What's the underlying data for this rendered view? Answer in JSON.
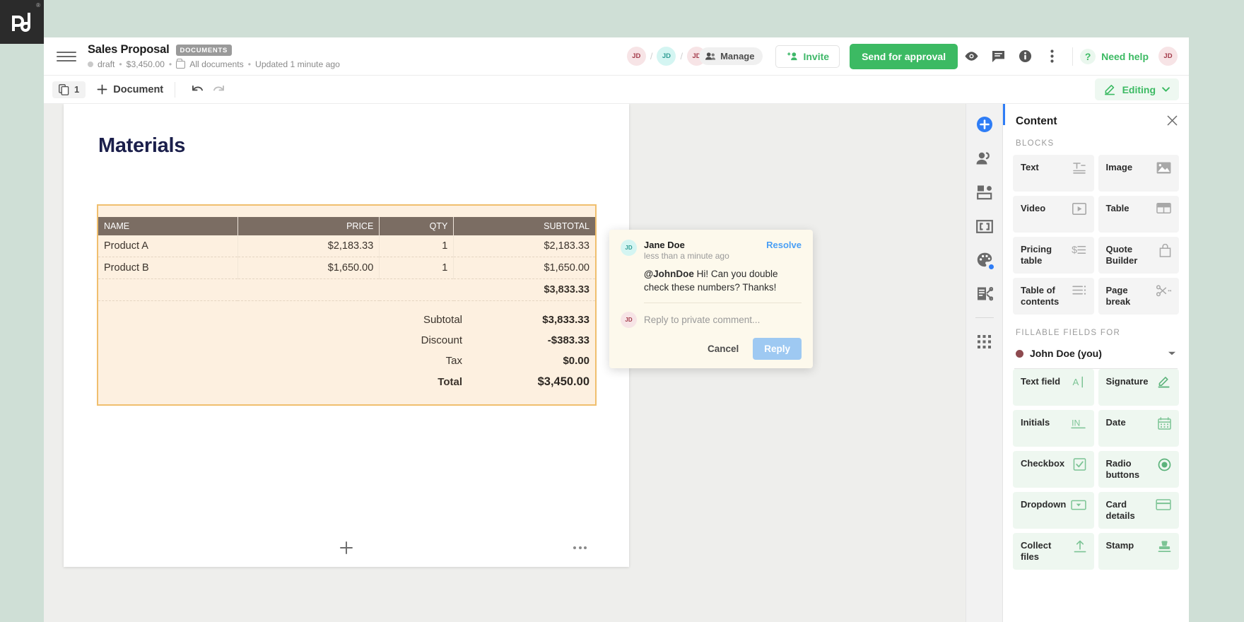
{
  "brand": {
    "logo_name": "pandadoc-logo",
    "registered_mark": "®"
  },
  "header": {
    "menu_icon": "hamburger-menu-icon",
    "title": "Sales Proposal",
    "badge": "DOCUMENTS",
    "status": "draft",
    "amount": "$3,450.00",
    "folder": "All documents",
    "updated": "Updated 1 minute ago",
    "sep": "•",
    "avatars": [
      {
        "initials": "JD",
        "color": "red"
      },
      {
        "initials": "JD",
        "color": "cyan"
      },
      {
        "initials": "JD",
        "color": "red"
      }
    ],
    "avatar_separator": "/",
    "manage_label": "Manage",
    "invite_label": "Invite",
    "send_label": "Send for approval",
    "icons": [
      "eye-icon",
      "comment-icon",
      "info-icon",
      "more-vertical-icon"
    ],
    "need_help_label": "Need help",
    "need_help_mark": "?",
    "profile_initials": "JD"
  },
  "toolbar": {
    "page_count": "1",
    "pages_icon": "pages-icon",
    "add_document_label": "Document",
    "add_icon": "plus-icon",
    "undo_icon": "undo-icon",
    "redo_icon": "redo-icon",
    "editing_label": "Editing",
    "editing_icon": "pencil-icon",
    "editing_caret": "chevron-down-icon"
  },
  "document": {
    "heading": "Materials",
    "table": {
      "columns": [
        "NAME",
        "PRICE",
        "QTY",
        "SUBTOTAL"
      ],
      "rows": [
        {
          "name": "Product A",
          "price": "$2,183.33",
          "qty": "1",
          "subtotal": "$2,183.33"
        },
        {
          "name": "Product B",
          "price": "$1,650.00",
          "qty": "1",
          "subtotal": "$1,650.00"
        }
      ],
      "items_sum": "$3,833.33",
      "totals": [
        {
          "label": "Subtotal",
          "value": "$3,833.33"
        },
        {
          "label": "Discount",
          "value": "-$383.33"
        },
        {
          "label": "Tax",
          "value": "$0.00"
        }
      ],
      "grand_label": "Total",
      "grand_value": "$3,450.00"
    },
    "footer": {
      "add_icon": "plus-icon",
      "more_icon": "more-horizontal-icon"
    }
  },
  "comment": {
    "author_initials": "JD",
    "author": "Jane Doe",
    "time": "less than a minute ago",
    "resolve_label": "Resolve",
    "mention": "@JohnDoe",
    "text": " Hi! Can you double check these numbers? Thanks!",
    "reply_avatar_initials": "JD",
    "reply_placeholder": "Reply to private comment...",
    "cancel_label": "Cancel",
    "reply_label": "Reply"
  },
  "rail": {
    "items": [
      {
        "icon": "add-circle-icon",
        "active": true
      },
      {
        "icon": "recipients-icon",
        "active": false
      },
      {
        "icon": "layout-blocks-icon",
        "active": false
      },
      {
        "icon": "variables-icon",
        "active": false
      },
      {
        "icon": "theme-palette-icon",
        "active": false,
        "badge": true
      },
      {
        "icon": "settings-doc-icon",
        "active": false
      },
      {
        "icon": "apps-grid-icon",
        "active": false
      }
    ]
  },
  "panel": {
    "title": "Content",
    "close_icon": "close-icon",
    "blocks_heading": "BLOCKS",
    "blocks": [
      {
        "label": "Text",
        "icon": "text-block-icon"
      },
      {
        "label": "Image",
        "icon": "image-icon"
      },
      {
        "label": "Video",
        "icon": "video-play-icon"
      },
      {
        "label": "Table",
        "icon": "table-icon"
      },
      {
        "label": "Pricing table",
        "icon": "pricing-table-icon"
      },
      {
        "label": "Quote Builder",
        "icon": "quote-bag-icon"
      },
      {
        "label": "Table of contents",
        "icon": "toc-list-icon"
      },
      {
        "label": "Page break",
        "icon": "scissors-icon"
      }
    ],
    "fillable_heading": "FILLABLE FIELDS FOR",
    "assignee": "John Doe (you)",
    "assignee_color": "#8d4a4f",
    "assignee_caret": "chevron-down-icon",
    "fields": [
      {
        "label": "Text field",
        "icon": "text-field-icon"
      },
      {
        "label": "Signature",
        "icon": "signature-pen-icon"
      },
      {
        "label": "Initials",
        "icon": "initials-icon"
      },
      {
        "label": "Date",
        "icon": "calendar-icon"
      },
      {
        "label": "Checkbox",
        "icon": "checkbox-icon"
      },
      {
        "label": "Radio buttons",
        "icon": "radio-button-icon"
      },
      {
        "label": "Dropdown",
        "icon": "dropdown-icon"
      },
      {
        "label": "Card details",
        "icon": "credit-card-icon"
      },
      {
        "label": "Collect files",
        "icon": "upload-icon"
      },
      {
        "label": "Stamp",
        "icon": "stamp-icon"
      }
    ]
  },
  "colors": {
    "brand_green": "#3cba63",
    "accent_blue": "#2f7df6",
    "table_border": "#f0bf6e",
    "table_bg": "#fdf0e0",
    "table_header": "#7b6d63",
    "desktop_bg": "#cfdfd6"
  }
}
